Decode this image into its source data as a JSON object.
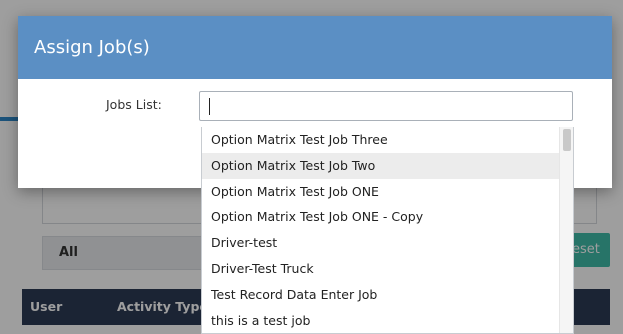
{
  "modal": {
    "title": "Assign Job(s)",
    "jobs_label": "Jobs List:",
    "jobs_input_value": ""
  },
  "dropdown": {
    "highlighted_index": 1,
    "items": [
      "Option Matrix Test Job Three",
      "Option Matrix Test Job Two",
      "Option Matrix Test Job ONE",
      "Option Matrix Test Job ONE - Copy",
      "Driver-test",
      "Driver-Test Truck",
      "Test Record Data Enter Job",
      "this is a test job"
    ]
  },
  "background": {
    "filter_all": "All",
    "reset_label": "eset",
    "columns": [
      "User",
      "Activity Type"
    ]
  },
  "colors": {
    "modal_header": "#5b8fc4",
    "table_header": "#2d3a55",
    "reset_button": "#3fbba9"
  }
}
